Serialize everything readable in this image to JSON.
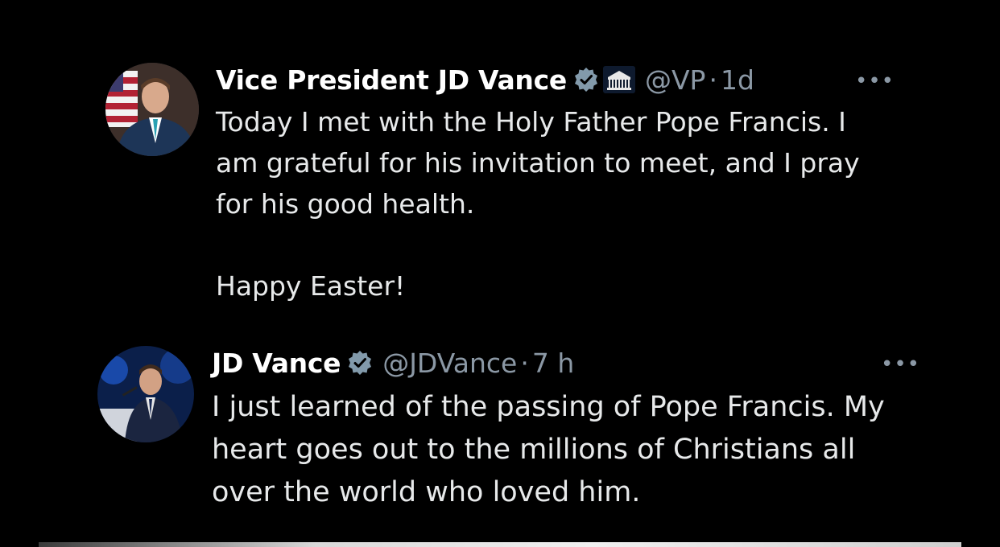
{
  "tweets": [
    {
      "display_name": "Vice President JD Vance",
      "handle": "@VP",
      "separator": "·",
      "time": "1d",
      "more": "•••",
      "verified_icon": "verified-badge-icon",
      "affiliation_icon": "white-house-icon",
      "paragraphs": [
        "Today I met with the Holy Father Pope Francis. I am grateful for his invitation to meet, and I pray for his good health.",
        "Happy Easter!"
      ]
    },
    {
      "display_name": "JD Vance",
      "handle": "@JDVance",
      "separator": "·",
      "time": "7 h",
      "more": "•••",
      "verified_icon": "verified-badge-icon",
      "paragraphs": [
        "I just learned of the passing of Pope Francis. My heart goes out to the millions of Christians all over the world who loved him."
      ]
    }
  ],
  "colors": {
    "background": "#000000",
    "text": "#e7e9ea",
    "secondary": "#8b98a5",
    "verified": "#829aab"
  }
}
